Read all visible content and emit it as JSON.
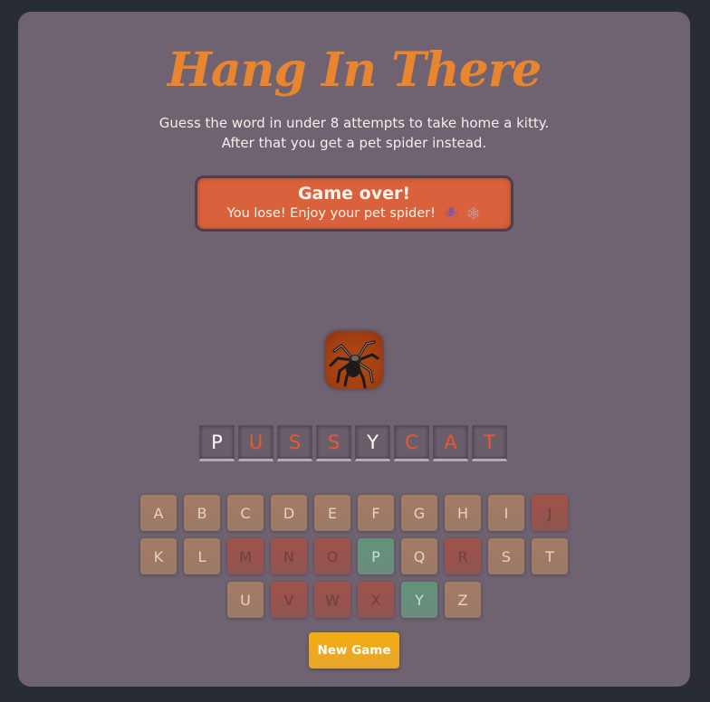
{
  "header": {
    "title": "Hang In There",
    "subtitle_line1": "Guess the word in under 8 attempts to take home a kitty.",
    "subtitle_line2": "After that you get a pet spider instead."
  },
  "status": {
    "title": "Game over!",
    "message": "You lose! Enjoy your pet spider!",
    "emoji_spider": "🕷",
    "emoji_web": "🕸"
  },
  "image": {
    "icon": "tarantula-image"
  },
  "word": [
    {
      "letter": "P",
      "state": "guessed"
    },
    {
      "letter": "U",
      "state": "missed"
    },
    {
      "letter": "S",
      "state": "missed"
    },
    {
      "letter": "S",
      "state": "missed"
    },
    {
      "letter": "Y",
      "state": "guessed"
    },
    {
      "letter": "C",
      "state": "missed"
    },
    {
      "letter": "A",
      "state": "missed"
    },
    {
      "letter": "T",
      "state": "missed"
    }
  ],
  "keyboard": {
    "row1": [
      {
        "letter": "A",
        "state": "unused"
      },
      {
        "letter": "B",
        "state": "unused"
      },
      {
        "letter": "C",
        "state": "unused"
      },
      {
        "letter": "D",
        "state": "unused"
      },
      {
        "letter": "E",
        "state": "unused"
      },
      {
        "letter": "F",
        "state": "unused"
      },
      {
        "letter": "G",
        "state": "unused"
      },
      {
        "letter": "H",
        "state": "unused"
      },
      {
        "letter": "I",
        "state": "unused"
      },
      {
        "letter": "J",
        "state": "wrong"
      }
    ],
    "row2": [
      {
        "letter": "K",
        "state": "unused"
      },
      {
        "letter": "L",
        "state": "unused"
      },
      {
        "letter": "M",
        "state": "wrong"
      },
      {
        "letter": "N",
        "state": "wrong"
      },
      {
        "letter": "O",
        "state": "wrong"
      },
      {
        "letter": "P",
        "state": "right"
      },
      {
        "letter": "Q",
        "state": "unused"
      },
      {
        "letter": "R",
        "state": "wrong"
      },
      {
        "letter": "S",
        "state": "unused"
      },
      {
        "letter": "T",
        "state": "unused"
      }
    ],
    "row3": [
      {
        "letter": "U",
        "state": "unused"
      },
      {
        "letter": "V",
        "state": "wrong"
      },
      {
        "letter": "W",
        "state": "wrong"
      },
      {
        "letter": "X",
        "state": "wrong"
      },
      {
        "letter": "Y",
        "state": "right"
      },
      {
        "letter": "Z",
        "state": "unused"
      }
    ]
  },
  "new_game_label": "New Game",
  "colors": {
    "background": "#282c34",
    "card": "#6f6271",
    "title": "#e8852e",
    "status": "#d9613c",
    "missed_letter": "#e55a2e",
    "key_unused": "#a57b64",
    "key_wrong": "#a05349",
    "key_right": "#62937b",
    "new_game": "#f3ae12"
  }
}
